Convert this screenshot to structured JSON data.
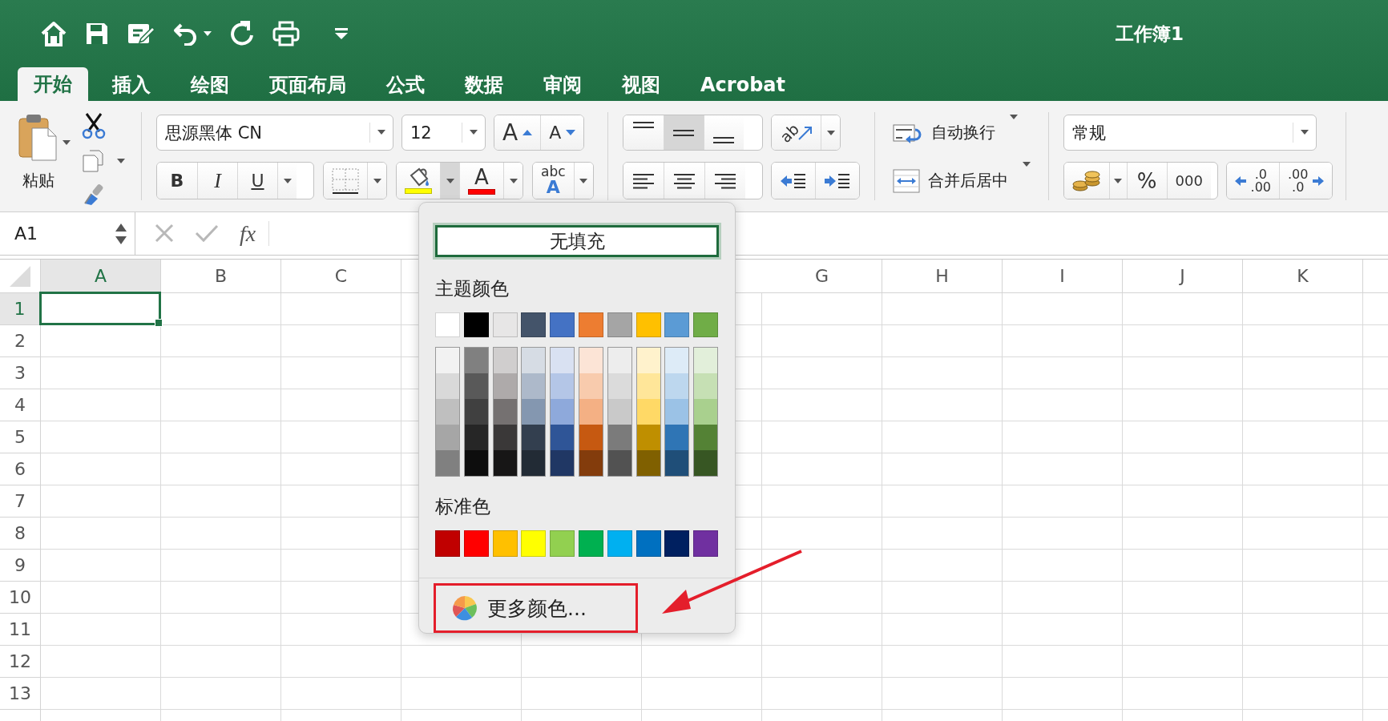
{
  "window": {
    "title": "工作簿1"
  },
  "tabs": [
    {
      "label": "开始",
      "selected": true
    },
    {
      "label": "插入",
      "selected": false
    },
    {
      "label": "绘图",
      "selected": false
    },
    {
      "label": "页面布局",
      "selected": false
    },
    {
      "label": "公式",
      "selected": false
    },
    {
      "label": "数据",
      "selected": false
    },
    {
      "label": "审阅",
      "selected": false
    },
    {
      "label": "视图",
      "selected": false
    },
    {
      "label": "Acrobat",
      "selected": false
    }
  ],
  "ribbon": {
    "paste_label": "粘贴",
    "font_name": "思源黑体 CN",
    "font_size": "12",
    "grow_font": "A",
    "shrink_font": "A",
    "bold": "B",
    "italic": "I",
    "underline": "U",
    "fill_color": {
      "color": "#ffff00",
      "menu_open": true
    },
    "font_color": {
      "label": "A",
      "color": "#ff0000"
    },
    "phonetic": {
      "top": "abc",
      "bottom": "A"
    },
    "vertical_align": [
      {
        "selected": false
      },
      {
        "selected": true
      },
      {
        "selected": false
      }
    ],
    "orientation": "ab",
    "wrap_text": "自动换行",
    "merge_center": "合并后居中",
    "number_format": "常规",
    "percent": "%",
    "comma": "000",
    "increase_decimal": {
      "top": ".0",
      "bottom": ".00"
    },
    "decrease_decimal": {
      "top": ".00",
      "bottom": ".0"
    }
  },
  "formula_bar": {
    "name_box": "A1",
    "function_label": "fx"
  },
  "sheet": {
    "columns_left": [
      {
        "label": "A",
        "selected": true
      },
      {
        "label": "B",
        "selected": false
      },
      {
        "label": "C",
        "selected": false
      }
    ],
    "columns_right": [
      {
        "label": "G",
        "selected": false
      },
      {
        "label": "H",
        "selected": false
      },
      {
        "label": "I",
        "selected": false
      },
      {
        "label": "J",
        "selected": false
      },
      {
        "label": "K",
        "selected": false
      }
    ],
    "rows": [
      {
        "label": "1",
        "selected": true
      },
      {
        "label": "2",
        "selected": false
      },
      {
        "label": "3",
        "selected": false
      },
      {
        "label": "4",
        "selected": false
      },
      {
        "label": "5",
        "selected": false
      },
      {
        "label": "6",
        "selected": false
      },
      {
        "label": "7",
        "selected": false
      },
      {
        "label": "8",
        "selected": false
      },
      {
        "label": "9",
        "selected": false
      },
      {
        "label": "10",
        "selected": false
      },
      {
        "label": "11",
        "selected": false
      },
      {
        "label": "12",
        "selected": false
      },
      {
        "label": "13",
        "selected": false
      }
    ]
  },
  "fill_menu": {
    "no_fill": "无填充",
    "theme_title": "主题颜色",
    "theme_colors": [
      {
        "color": "#ffffff"
      },
      {
        "color": "#000000"
      },
      {
        "color": "#e7e6e6"
      },
      {
        "color": "#44546a"
      },
      {
        "color": "#4472c4"
      },
      {
        "color": "#ed7d31"
      },
      {
        "color": "#a5a5a5"
      },
      {
        "color": "#ffc000"
      },
      {
        "color": "#5b9bd5"
      },
      {
        "color": "#70ad47"
      }
    ],
    "tint_columns": [
      {
        "swatches": [
          {
            "color": "#f2f2f2"
          },
          {
            "color": "#d9d9d9"
          },
          {
            "color": "#bfbfbf"
          },
          {
            "color": "#a6a6a6"
          },
          {
            "color": "#808080"
          }
        ]
      },
      {
        "swatches": [
          {
            "color": "#808080"
          },
          {
            "color": "#595959"
          },
          {
            "color": "#404040"
          },
          {
            "color": "#262626"
          },
          {
            "color": "#0d0d0d"
          }
        ]
      },
      {
        "swatches": [
          {
            "color": "#d0cece"
          },
          {
            "color": "#aeaaaa"
          },
          {
            "color": "#757171"
          },
          {
            "color": "#3a3838"
          },
          {
            "color": "#171616"
          }
        ]
      },
      {
        "swatches": [
          {
            "color": "#d6dce4"
          },
          {
            "color": "#adb9ca"
          },
          {
            "color": "#8497b0"
          },
          {
            "color": "#333f4f"
          },
          {
            "color": "#222b35"
          }
        ]
      },
      {
        "swatches": [
          {
            "color": "#d9e1f2"
          },
          {
            "color": "#b4c6e7"
          },
          {
            "color": "#8ea9db"
          },
          {
            "color": "#2f5597"
          },
          {
            "color": "#203764"
          }
        ]
      },
      {
        "swatches": [
          {
            "color": "#fce4d6"
          },
          {
            "color": "#f8cbad"
          },
          {
            "color": "#f4b084"
          },
          {
            "color": "#c65911"
          },
          {
            "color": "#833c0c"
          }
        ]
      },
      {
        "swatches": [
          {
            "color": "#ededed"
          },
          {
            "color": "#dbdbdb"
          },
          {
            "color": "#c9c9c9"
          },
          {
            "color": "#7b7b7b"
          },
          {
            "color": "#525252"
          }
        ]
      },
      {
        "swatches": [
          {
            "color": "#fff2cc"
          },
          {
            "color": "#ffe699"
          },
          {
            "color": "#ffd966"
          },
          {
            "color": "#bf8f00"
          },
          {
            "color": "#806000"
          }
        ]
      },
      {
        "swatches": [
          {
            "color": "#ddebf7"
          },
          {
            "color": "#bdd7ee"
          },
          {
            "color": "#9bc2e6"
          },
          {
            "color": "#2f75b5"
          },
          {
            "color": "#1f4e78"
          }
        ]
      },
      {
        "swatches": [
          {
            "color": "#e2efda"
          },
          {
            "color": "#c6e0b4"
          },
          {
            "color": "#a9d08e"
          },
          {
            "color": "#548235"
          },
          {
            "color": "#375623"
          }
        ]
      }
    ],
    "standard_title": "标准色",
    "standard_colors": [
      {
        "color": "#c00000"
      },
      {
        "color": "#ff0000"
      },
      {
        "color": "#ffc000"
      },
      {
        "color": "#ffff00"
      },
      {
        "color": "#92d050"
      },
      {
        "color": "#00b050"
      },
      {
        "color": "#00b0f0"
      },
      {
        "color": "#0070c0"
      },
      {
        "color": "#002060"
      },
      {
        "color": "#7030a0"
      }
    ],
    "more_colors": "更多颜色...",
    "more_colors_highlighted": true
  }
}
